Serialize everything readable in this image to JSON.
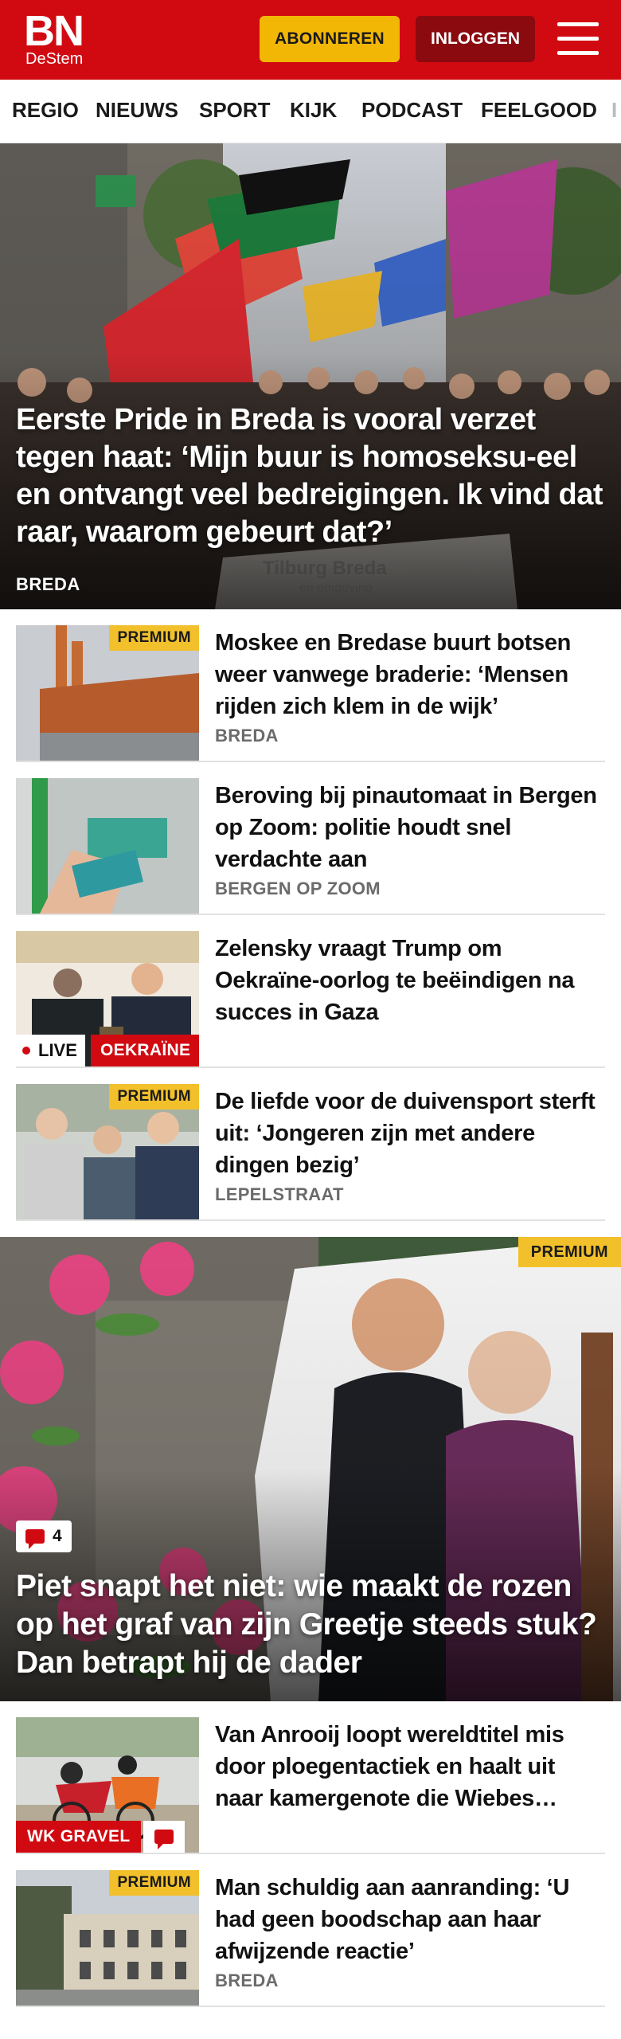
{
  "header": {
    "logo_main": "BN",
    "logo_sub": "DeStem",
    "subscribe_label": "ABONNEREN",
    "login_label": "INLOGGEN"
  },
  "nav": {
    "items": [
      "REGIO",
      "NIEUWS",
      "SPORT",
      "KIJK",
      "PODCAST",
      "FEELGOOD",
      "I"
    ]
  },
  "hero": {
    "title": "Eerste Pride in Breda is vooral verzet tegen haat: ‘Mijn buur is homoseksu-eel en ontvangt veel bedreigingen. Ik vind dat raar, waarom gebeurt dat?’",
    "region": "BREDA",
    "banner_text": "Tilburg Breda",
    "banner_subtext": "en omgeving"
  },
  "articles": [
    {
      "title": "Moskee en Bredase buurt botsen weer vanwege braderie: ‘Mensen rijden zich klem in de wijk’",
      "region": "BREDA",
      "badge": "PREMIUM"
    },
    {
      "title": "Beroving bij pinautomaat in Bergen op Zoom: politie houdt snel verdachte aan",
      "region": "BERGEN OP ZOOM"
    },
    {
      "title": "Zelensky vraagt Trump om Oekraïne-oorlog te beëindigen na succes in Gaza",
      "live_label": "LIVE",
      "tag": "OEKRAÏNE"
    },
    {
      "title": "De liefde voor de duivensport sterft uit: ‘Jongeren zijn met andere dingen bezig’",
      "region": "LEPELSTRAAT",
      "badge": "PREMIUM"
    }
  ],
  "feature": {
    "title": "Piet snapt het niet: wie maakt de rozen op het graf van zijn Greetje steeds stuk? Dan betrapt hij de dader",
    "badge": "PREMIUM",
    "comment_count": "4"
  },
  "articles_bottom": [
    {
      "title": "Van Anrooij loopt wereldtitel mis door ploegentactiek en haalt uit naar kamergenote die Wiebes…",
      "tag": "WK GRAVEL"
    },
    {
      "title": "Man schuldig aan aanranding: ‘U had geen boodschap aan haar afwijzende reactie’",
      "region": "BREDA",
      "badge": "PREMIUM"
    }
  ],
  "colors": {
    "brand_red": "#d10a11",
    "subscribe_yellow": "#f2b705",
    "premium_yellow": "#f2c02b",
    "login_dark_red": "#8a0a10"
  }
}
